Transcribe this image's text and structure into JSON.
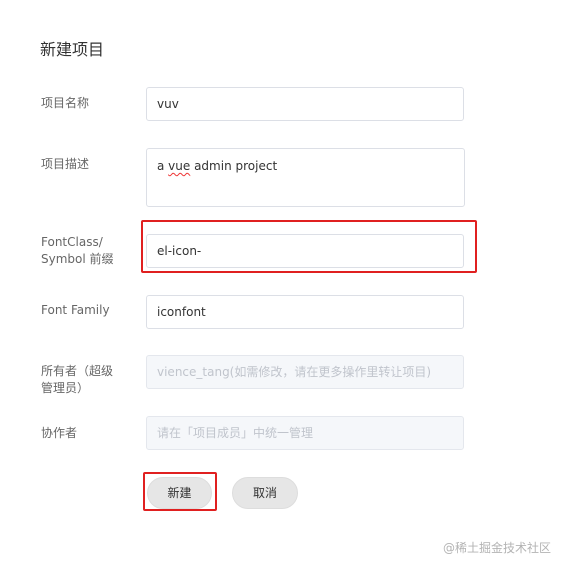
{
  "dialog": {
    "title": "新建项目"
  },
  "form": {
    "project_name": {
      "label": "项目名称",
      "value": "vuv"
    },
    "description": {
      "label": "项目描述",
      "value_prefix": "a ",
      "value_flagged_word": "vue",
      "value_suffix": " admin project"
    },
    "font_class": {
      "label_line1": "FontClass/",
      "label_line2": "Symbol 前缀",
      "value": "el-icon-"
    },
    "font_family": {
      "label": "Font Family",
      "value": "iconfont"
    },
    "owner": {
      "label_line1": "所有者（超级",
      "label_line2": "管理员）",
      "value": "vience_tang(如需修改，请在更多操作里转让项目)"
    },
    "collaborators": {
      "label": "协作者",
      "placeholder": "请在「项目成员」中统一管理"
    }
  },
  "buttons": {
    "create_label": "新建",
    "cancel_label": "取消"
  },
  "watermark": "@稀土掘金技术社区",
  "colors": {
    "highlight": "#e02020",
    "button_bg": "#e6e6e6",
    "input_border": "#dcdfe6"
  }
}
